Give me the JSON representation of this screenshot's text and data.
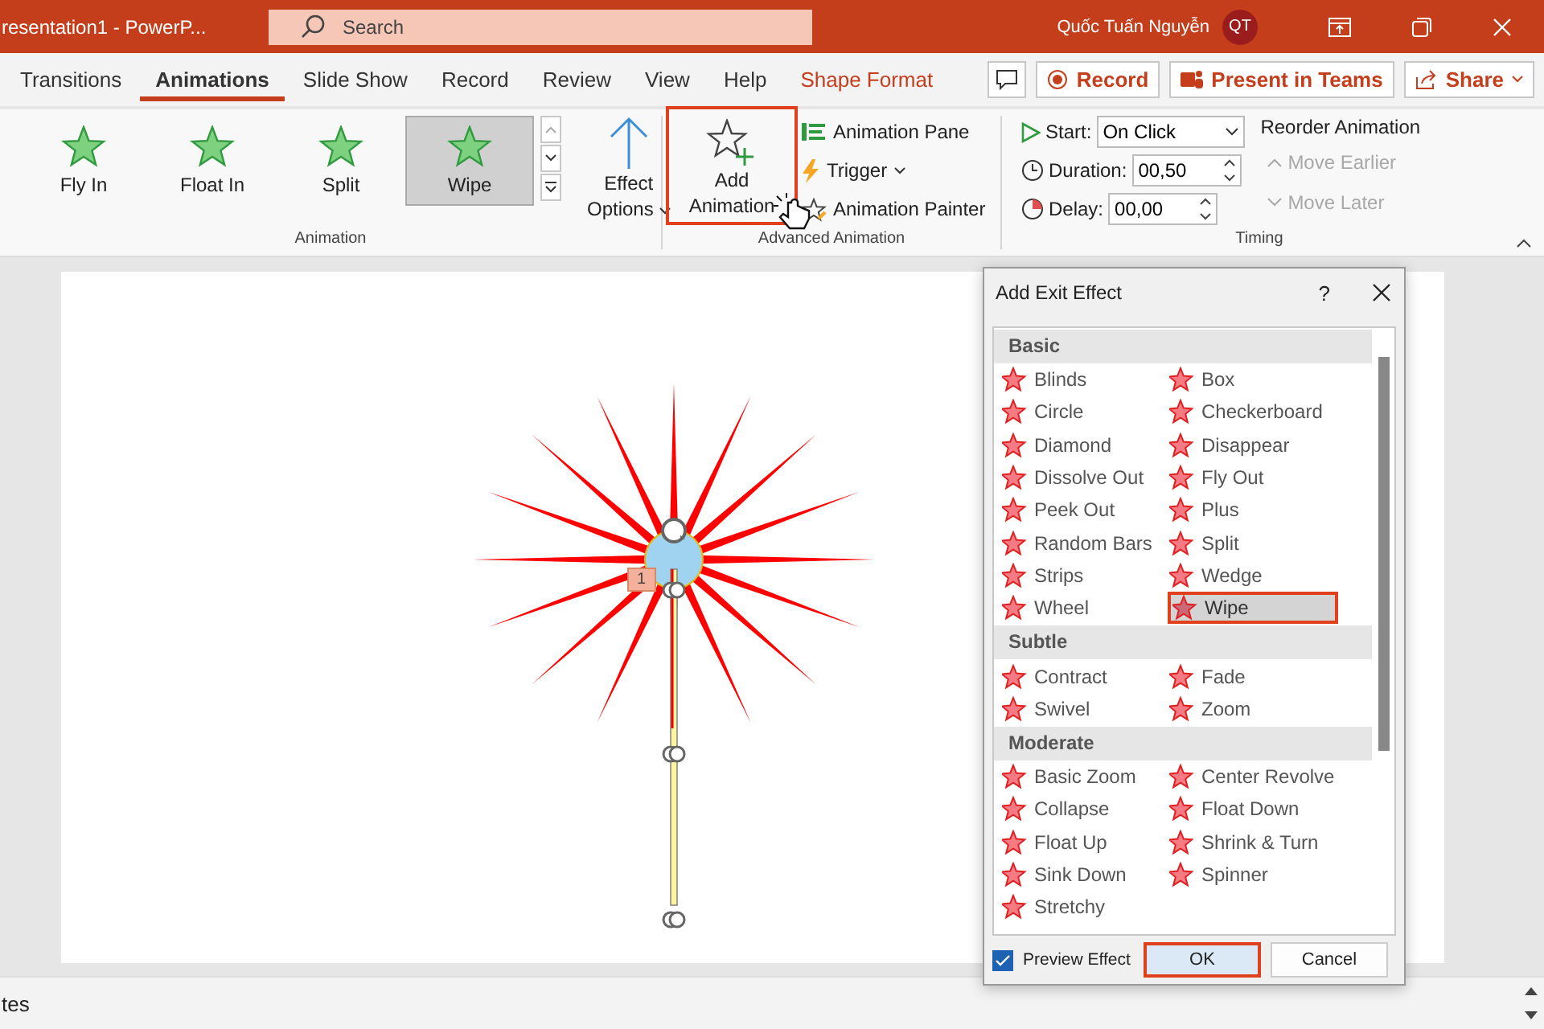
{
  "title_bar": {
    "doc_title": "resentation1  -  PowerP...",
    "search_placeholder": "Search",
    "user_name": "Quốc Tuấn Nguyễn",
    "avatar_initials": "QT"
  },
  "tabs": [
    {
      "label": "Transitions",
      "selected": false,
      "kind": "normal"
    },
    {
      "label": "Animations",
      "selected": true,
      "kind": "normal"
    },
    {
      "label": "Slide Show",
      "selected": false,
      "kind": "normal"
    },
    {
      "label": "Record",
      "selected": false,
      "kind": "normal"
    },
    {
      "label": "Review",
      "selected": false,
      "kind": "normal"
    },
    {
      "label": "View",
      "selected": false,
      "kind": "normal"
    },
    {
      "label": "Help",
      "selected": false,
      "kind": "normal"
    },
    {
      "label": "Shape Format",
      "selected": false,
      "kind": "contextual"
    }
  ],
  "actions": {
    "record": "Record",
    "present": "Present in Teams",
    "share": "Share"
  },
  "ribbon": {
    "gallery": {
      "group_label": "Animation",
      "items": [
        {
          "label": "Fly In",
          "selected": false
        },
        {
          "label": "Float In",
          "selected": false
        },
        {
          "label": "Split",
          "selected": false
        },
        {
          "label": "Wipe",
          "selected": true
        }
      ]
    },
    "effect_options": {
      "line_1": "Effect",
      "line_2": "Options"
    },
    "add_animation": {
      "line_1": "Add",
      "line_2": "Animation",
      "highlighted": true
    },
    "advanced": {
      "group_label": "Advanced Animation",
      "pane": "Animation Pane",
      "trigger": "Trigger",
      "painter": "Animation Painter"
    },
    "timing": {
      "group_label": "Timing",
      "start_label": "Start:",
      "start_value": "On Click",
      "duration_label": "Duration:",
      "duration_value": "00,50",
      "delay_label": "Delay:",
      "delay_value": "00,00"
    },
    "reorder": {
      "title": "Reorder Animation",
      "items": [
        {
          "label": "Move Earlier",
          "disabled": true
        },
        {
          "label": "Move Later",
          "disabled": true
        }
      ]
    }
  },
  "slide": {
    "animation_tag": "1"
  },
  "dialog": {
    "title": "Add Exit Effect",
    "help": "?",
    "sections": [
      {
        "title": "Basic",
        "effects": [
          {
            "label": "Blinds",
            "selected": false
          },
          {
            "label": "Box",
            "selected": false
          },
          {
            "label": "Circle",
            "selected": false
          },
          {
            "label": "Checkerboard",
            "selected": false
          },
          {
            "label": "Diamond",
            "selected": false
          },
          {
            "label": "Disappear",
            "selected": false
          },
          {
            "label": "Dissolve Out",
            "selected": false
          },
          {
            "label": "Fly Out",
            "selected": false
          },
          {
            "label": "Peek Out",
            "selected": false
          },
          {
            "label": "Plus",
            "selected": false
          },
          {
            "label": "Random Bars",
            "selected": false
          },
          {
            "label": "Split",
            "selected": false
          },
          {
            "label": "Strips",
            "selected": false
          },
          {
            "label": "Wedge",
            "selected": false
          },
          {
            "label": "Wheel",
            "selected": false
          },
          {
            "label": "Wipe",
            "selected": true
          }
        ]
      },
      {
        "title": "Subtle",
        "effects": [
          {
            "label": "Contract",
            "selected": false
          },
          {
            "label": "Fade",
            "selected": false
          },
          {
            "label": "Swivel",
            "selected": false
          },
          {
            "label": "Zoom",
            "selected": false
          }
        ]
      },
      {
        "title": "Moderate",
        "effects": [
          {
            "label": "Basic Zoom",
            "selected": false
          },
          {
            "label": "Center Revolve",
            "selected": false
          },
          {
            "label": "Collapse",
            "selected": false
          },
          {
            "label": "Float Down",
            "selected": false
          },
          {
            "label": "Float Up",
            "selected": false
          },
          {
            "label": "Shrink & Turn",
            "selected": false
          },
          {
            "label": "Sink Down",
            "selected": false
          },
          {
            "label": "Spinner",
            "selected": false
          },
          {
            "label": "Stretchy",
            "selected": false
          }
        ]
      }
    ],
    "preview": {
      "label": "Preview Effect",
      "checked": true
    },
    "ok": {
      "label": "OK",
      "highlighted": true
    },
    "cancel": "Cancel"
  },
  "status_bar": {
    "notes": "tes"
  }
}
